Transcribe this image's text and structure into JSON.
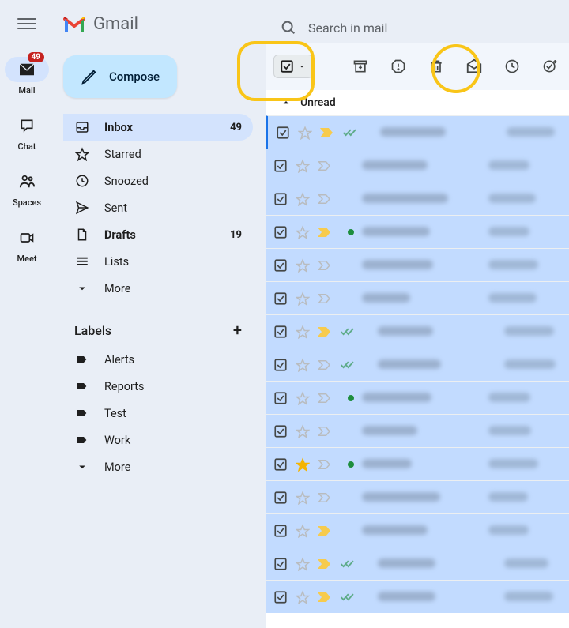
{
  "app": {
    "name": "Gmail"
  },
  "search": {
    "placeholder": "Search in mail"
  },
  "mail_badge": "49",
  "rail": [
    {
      "key": "mail",
      "label": "Mail",
      "active": true
    },
    {
      "key": "chat",
      "label": "Chat",
      "active": false
    },
    {
      "key": "spaces",
      "label": "Spaces",
      "active": false
    },
    {
      "key": "meet",
      "label": "Meet",
      "active": false
    }
  ],
  "compose_label": "Compose",
  "nav": [
    {
      "key": "inbox",
      "label": "Inbox",
      "count": "49",
      "active": true,
      "bold": true
    },
    {
      "key": "starred",
      "label": "Starred",
      "count": "",
      "active": false,
      "bold": false
    },
    {
      "key": "snoozed",
      "label": "Snoozed",
      "count": "",
      "active": false,
      "bold": false
    },
    {
      "key": "sent",
      "label": "Sent",
      "count": "",
      "active": false,
      "bold": false
    },
    {
      "key": "drafts",
      "label": "Drafts",
      "count": "19",
      "active": false,
      "bold": true
    },
    {
      "key": "lists",
      "label": "Lists",
      "count": "",
      "active": false,
      "bold": false
    },
    {
      "key": "more",
      "label": "More",
      "count": "",
      "active": false,
      "bold": false
    }
  ],
  "labels_header": "Labels",
  "labels": [
    {
      "label": "Alerts"
    },
    {
      "label": "Reports"
    },
    {
      "label": "Test"
    },
    {
      "label": "Work"
    },
    {
      "label": "More"
    }
  ],
  "section_title": "Unread",
  "messages": [
    {
      "checked": true,
      "starred": false,
      "important": true,
      "dchecks": true,
      "dot": false
    },
    {
      "checked": true,
      "starred": false,
      "important": false,
      "dchecks": false,
      "dot": false
    },
    {
      "checked": true,
      "starred": false,
      "important": false,
      "dchecks": false,
      "dot": false
    },
    {
      "checked": true,
      "starred": false,
      "important": true,
      "dchecks": false,
      "dot": true
    },
    {
      "checked": true,
      "starred": false,
      "important": false,
      "dchecks": false,
      "dot": false
    },
    {
      "checked": true,
      "starred": false,
      "important": false,
      "dchecks": false,
      "dot": false
    },
    {
      "checked": true,
      "starred": false,
      "important": true,
      "dchecks": true,
      "dot": false
    },
    {
      "checked": true,
      "starred": false,
      "important": false,
      "dchecks": true,
      "dot": false
    },
    {
      "checked": true,
      "starred": false,
      "important": false,
      "dchecks": false,
      "dot": true
    },
    {
      "checked": true,
      "starred": false,
      "important": false,
      "dchecks": false,
      "dot": false
    },
    {
      "checked": true,
      "starred": true,
      "important": false,
      "dchecks": false,
      "dot": true
    },
    {
      "checked": true,
      "starred": false,
      "important": false,
      "dchecks": false,
      "dot": false
    },
    {
      "checked": true,
      "starred": false,
      "important": true,
      "dchecks": false,
      "dot": false
    },
    {
      "checked": true,
      "starred": false,
      "important": true,
      "dchecks": true,
      "dot": false
    },
    {
      "checked": true,
      "starred": false,
      "important": true,
      "dchecks": true,
      "dot": false
    }
  ]
}
